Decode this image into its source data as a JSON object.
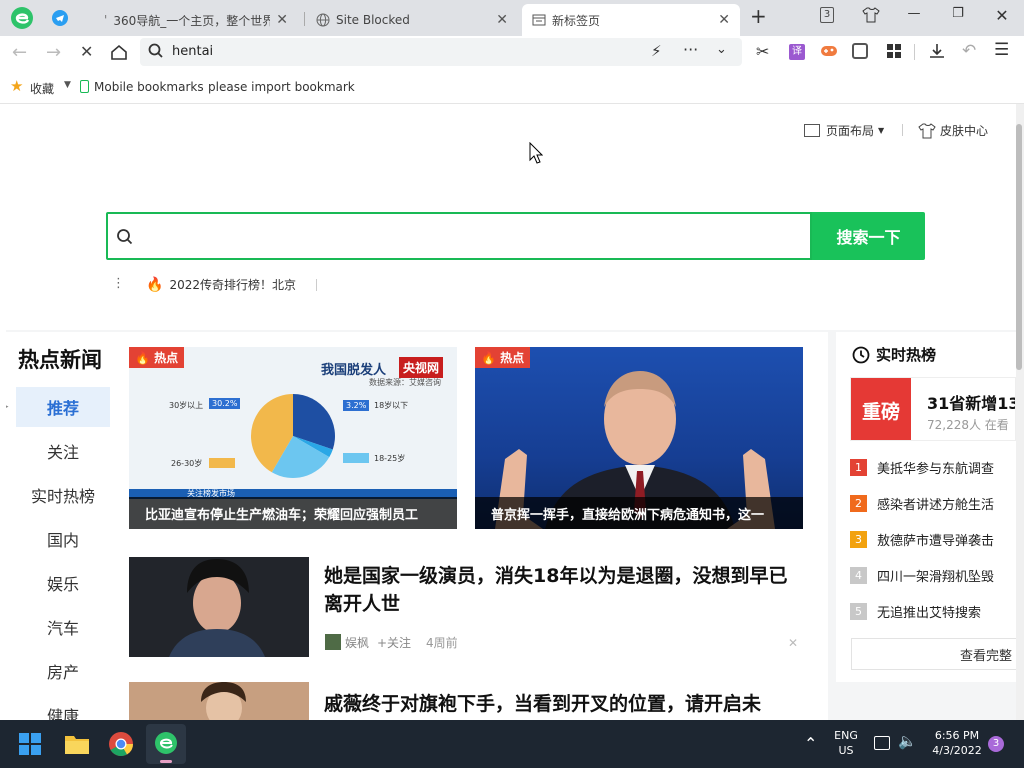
{
  "browser": {
    "tabs": [
      {
        "title": "360导航_一个主页，整个世界",
        "favicon": "360-icon",
        "active": false
      },
      {
        "title": "Site Blocked",
        "favicon": "globe-icon",
        "active": false
      },
      {
        "title": "新标签页",
        "favicon": "newtab-icon",
        "active": true
      }
    ],
    "new_tab_symbol": "+",
    "tab_count_badge": "3",
    "address": "hentai"
  },
  "bookmarks_bar": {
    "favorites_label": "收藏",
    "items": [
      "Mobile bookmarks",
      "please import bookmark"
    ]
  },
  "newtab": {
    "layout_menu": "页面布局",
    "skin_center": "皮肤中心",
    "search_button": "搜索一下",
    "hot_suggestion": "2022传奇排行榜！北京"
  },
  "news": {
    "section_title": "热点新闻",
    "categories": [
      "推荐",
      "关注",
      "实时热榜",
      "国内",
      "娱乐",
      "汽车",
      "房产",
      "健康"
    ],
    "active_category": "推荐",
    "hot_badge": "热点",
    "feature_cards": [
      {
        "caption": "比亚迪宣布停止生产燃油车；荣耀回应强制员工",
        "image_title": "我国脱发人",
        "image_source_logo": "央视网",
        "image_note": "数据来源：艾媒咨询",
        "pie_data": {
          "type": "pie",
          "labels": [
            "30岁以上",
            "18岁以下",
            "18-25岁",
            "26-30岁"
          ],
          "values": [
            30.2,
            3.2,
            25.0,
            41.6
          ],
          "value_labels": [
            "30.2%",
            "3.2%",
            "",
            ""
          ],
          "colors": [
            "#1e4fa3",
            "#2aa7e6",
            "#6cc6f0",
            "#f2b84b"
          ]
        },
        "ticker_text": "关注榜发市场"
      },
      {
        "caption": "普京挥一挥手，直接给欧洲下病危通知书，这一"
      }
    ],
    "articles": [
      {
        "title": "她是国家一级演员，消失18年以为是退圈，没想到早已离开人世",
        "author": "娱枫",
        "follow": "+关注",
        "time": "4周前"
      },
      {
        "title": "戚薇终于对旗袍下手，当看到开叉的位置，请开启未"
      }
    ]
  },
  "trending": {
    "title": "实时热榜",
    "top_badge": "重磅",
    "top_title": "31省新增13",
    "top_meta": "72,228人 在看",
    "items": [
      {
        "rank": "1",
        "text": "美抵华参与东航调查",
        "color": "#e34234"
      },
      {
        "rank": "2",
        "text": "感染者讲述方舱生活",
        "color": "#f06a1c"
      },
      {
        "rank": "3",
        "text": "敖德萨市遭导弹袭击",
        "color": "#f2a20f"
      },
      {
        "rank": "4",
        "text": "四川一架滑翔机坠毁",
        "color": "#c8c8c8"
      },
      {
        "rank": "5",
        "text": "无追推出艾特搜索",
        "color": "#c8c8c8"
      }
    ],
    "more_label": "查看完整"
  },
  "taskbar": {
    "apps": [
      "start-icon",
      "file-explorer-icon",
      "chrome-icon",
      "360-browser-icon"
    ],
    "language": "ENG",
    "region": "US",
    "time": "6:56 PM",
    "date": "4/3/2022",
    "notification_count": "3"
  }
}
